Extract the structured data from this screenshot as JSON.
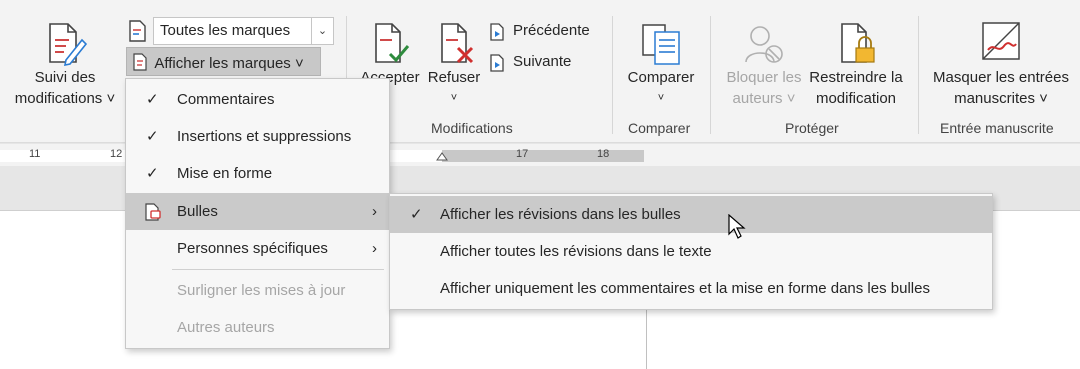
{
  "ribbon": {
    "suivi": {
      "line1": "Suivi des",
      "line2": "modifications ˅"
    },
    "markup_combo": "Toutes les marques",
    "show_markup": "Afficher les marques ˅",
    "accept": "Accepter",
    "reject": "Refuser",
    "previous": "Précédente",
    "next": "Suivante",
    "group_modifications": "Modifications",
    "compare": "Comparer",
    "group_compare": "Comparer",
    "block": {
      "line1": "Bloquer les",
      "line2": "auteurs ˅"
    },
    "restrict": {
      "line1": "Restreindre la",
      "line2": "modification"
    },
    "group_protect": "Protéger",
    "ink": {
      "line1": "Masquer les entrées",
      "line2": "manuscrites ˅"
    },
    "group_ink": "Entrée manuscrite"
  },
  "ruler": {
    "t11": "11",
    "t12": "12",
    "t17": "17",
    "t18": "18"
  },
  "menu": {
    "comments": "Commentaires",
    "insertions": "Insertions et suppressions",
    "formatting": "Mise en forme",
    "bubbles": "Bulles",
    "people": "Personnes spécifiques",
    "highlight": "Surligner les mises à jour",
    "other_authors": "Autres auteurs"
  },
  "submenu": {
    "revisions_in_bubbles": "Afficher les révisions dans les bulles",
    "all_inline": "Afficher toutes les révisions dans le texte",
    "comments_only": "Afficher uniquement les commentaires et la mise en forme dans les bulles"
  }
}
